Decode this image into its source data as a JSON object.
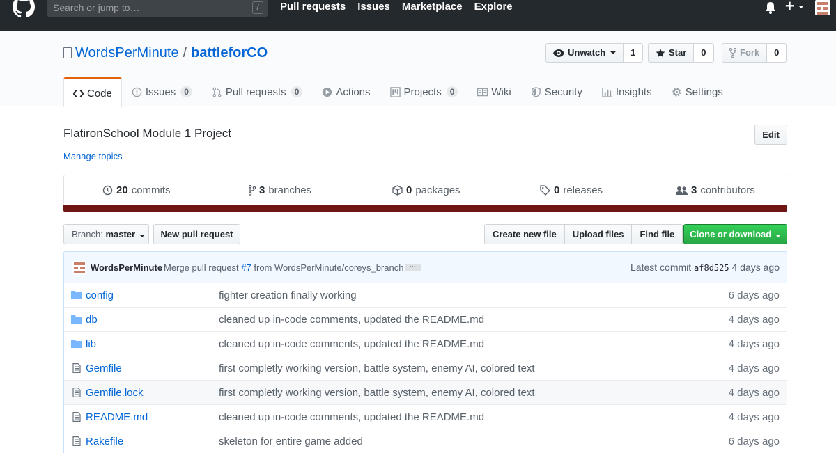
{
  "header": {
    "search_placeholder": "Search or jump to…",
    "search_shortcut": "/",
    "nav": [
      "Pull requests",
      "Issues",
      "Marketplace",
      "Explore"
    ],
    "plus_label": "+"
  },
  "repo": {
    "owner": "WordsPerMinute",
    "separator": "/",
    "name": "battleforCO",
    "watch_label": "Unwatch",
    "watch_count": "1",
    "star_label": "Star",
    "star_count": "0",
    "fork_label": "Fork",
    "fork_count": "0"
  },
  "tabs": [
    {
      "label": "Code",
      "icon": "code-icon"
    },
    {
      "label": "Issues",
      "count": "0",
      "icon": "issue-icon"
    },
    {
      "label": "Pull requests",
      "count": "0",
      "icon": "pull-request-icon"
    },
    {
      "label": "Actions",
      "icon": "play-icon"
    },
    {
      "label": "Projects",
      "count": "0",
      "icon": "project-icon"
    },
    {
      "label": "Wiki",
      "icon": "book-icon"
    },
    {
      "label": "Security",
      "icon": "shield-icon"
    },
    {
      "label": "Insights",
      "icon": "graph-icon"
    },
    {
      "label": "Settings",
      "icon": "gear-icon"
    }
  ],
  "about": {
    "description": "FlatironSchool Module 1 Project",
    "manage_topics": "Manage topics",
    "edit_label": "Edit"
  },
  "summary": {
    "commits_count": "20",
    "commits_label": "commits",
    "branches_count": "3",
    "branches_label": "branches",
    "packages_count": "0",
    "packages_label": "packages",
    "releases_count": "0",
    "releases_label": "releases",
    "contributors_count": "3",
    "contributors_label": "contributors",
    "language_color": "#701516"
  },
  "filenav": {
    "branch_prefix": "Branch:",
    "branch_name": "master",
    "new_pr": "New pull request",
    "create_file": "Create new file",
    "upload_files": "Upload files",
    "find_file": "Find file",
    "clone": "Clone or download"
  },
  "latest_commit": {
    "author": "WordsPerMinute",
    "message_prefix": "Merge pull request",
    "pr_link": "#7",
    "message_suffix": "from WordsPerMinute/coreys_branch",
    "ellipsis": "…",
    "latest_label": "Latest commit",
    "sha": "af8d525",
    "age": "4 days ago"
  },
  "files": [
    {
      "name": "config",
      "type": "dir",
      "message": "fighter creation finally working",
      "age": "6 days ago"
    },
    {
      "name": "db",
      "type": "dir",
      "message": "cleaned up in-code comments, updated the README.md",
      "age": "4 days ago"
    },
    {
      "name": "lib",
      "type": "dir",
      "message": "cleaned up in-code comments, updated the README.md",
      "age": "4 days ago"
    },
    {
      "name": "Gemfile",
      "type": "file",
      "message": "first completly working version, battle system, enemy AI, colored text",
      "age": "4 days ago"
    },
    {
      "name": "Gemfile.lock",
      "type": "file",
      "message": "first completly working version, battle system, enemy AI, colored text",
      "age": "4 days ago"
    },
    {
      "name": "README.md",
      "type": "file",
      "message": "cleaned up in-code comments, updated the README.md",
      "age": "4 days ago"
    },
    {
      "name": "Rakefile",
      "type": "file",
      "message": "skeleton for entire game added",
      "age": "6 days ago"
    }
  ]
}
